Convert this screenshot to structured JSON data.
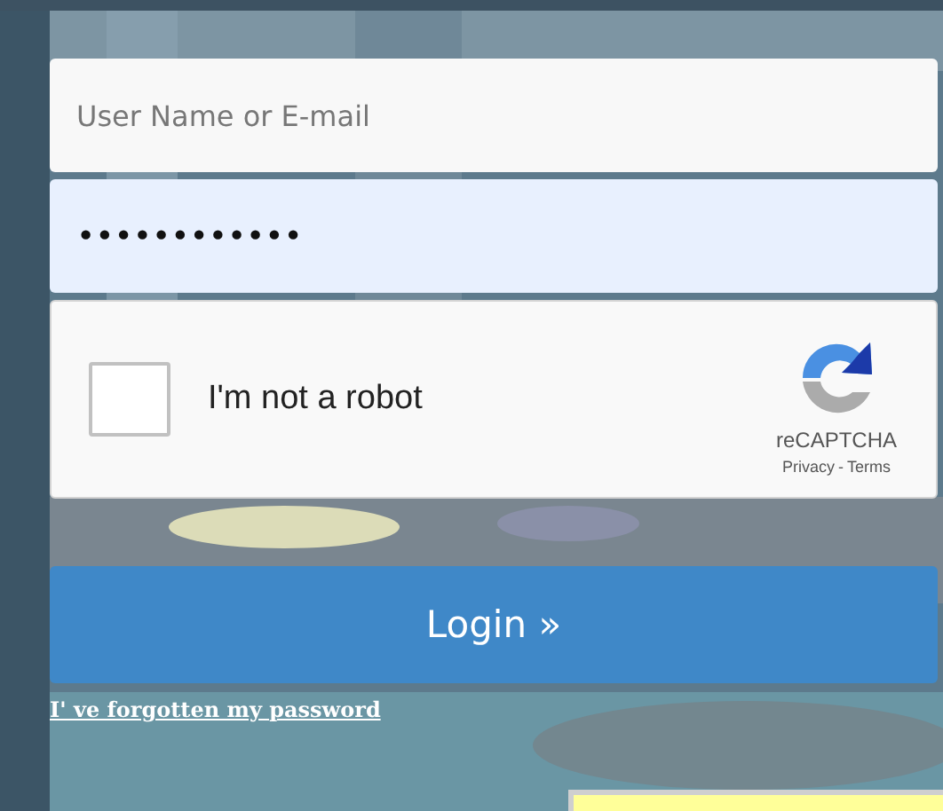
{
  "login_form": {
    "username": {
      "placeholder": "User Name or E-mail"
    },
    "password": {
      "value": "••••••••••••"
    },
    "captcha": {
      "label": "I'm not a robot",
      "checked": false,
      "brand": "reCAPTCHA",
      "privacy_link": "Privacy",
      "separator": "-",
      "terms_link": "Terms"
    },
    "submit_button": "Login »",
    "forgot_link": "I' ve forgotten my password"
  }
}
